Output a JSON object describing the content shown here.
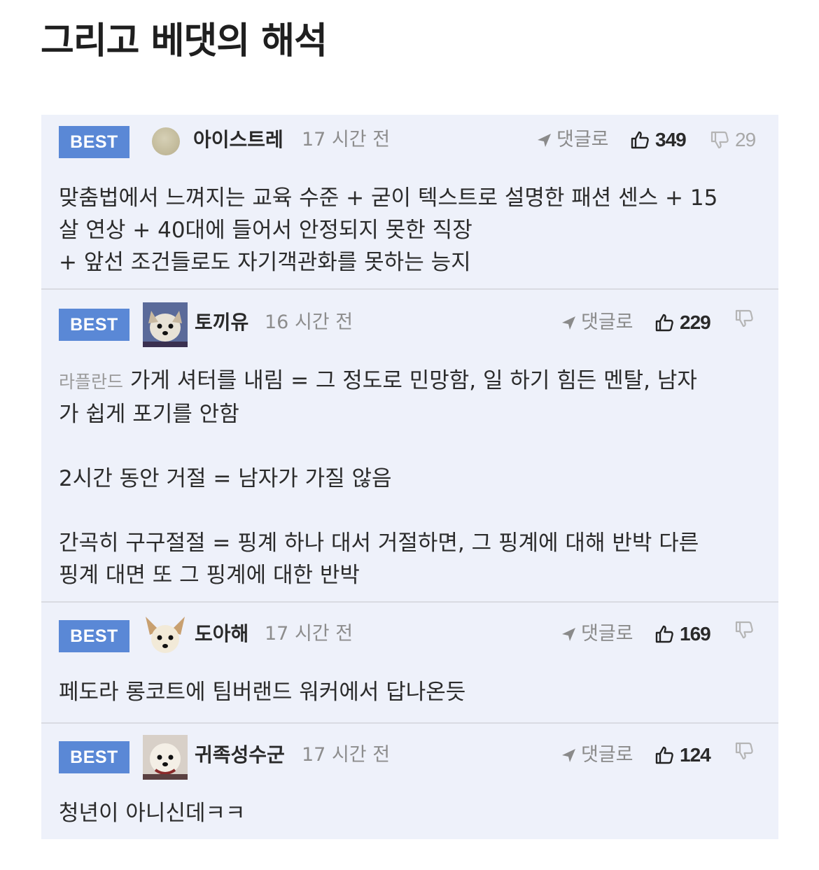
{
  "page": {
    "title": "그리고 베댓의 해석"
  },
  "ui": {
    "reply_label": "댓글로",
    "best_label": "BEST"
  },
  "colors": {
    "best_badge": "#5a88d6",
    "panel_bg": "#eef1fa",
    "divider": "#d9dbe2"
  },
  "comments": [
    {
      "username": "아이스트레",
      "time": "17 시간 전",
      "likes": "349",
      "dislikes": "29",
      "avatar_icon": "plain-circle-avatar",
      "lines": [
        "맞춤법에서 느껴지는 교육 수준 + 굳이 텍스트로 설명한 패션 센스 + 15",
        "살 연상 + 40대에 들어서 안정되지 못한 직장",
        "+ 앞선 조건들로도 자기객관화를 못하는 능지"
      ]
    },
    {
      "username": "토끼유",
      "time": "16 시간 전",
      "likes": "229",
      "dislikes": "",
      "avatar_icon": "dog-avatar",
      "mention": "라플란드",
      "lines": [
        "가게 셔터를 내림 = 그 정도로 민망함, 일 하기 힘든 멘탈, 남자",
        "가 쉽게 포기를 안함",
        "2시간 동안 거절 = 남자가 가질 않음",
        "간곡히 구구절절 = 핑계 하나 대서 거절하면, 그 핑계에 대해 반박 다른",
        "핑계 대면 또 그 핑계에 대한 반박"
      ]
    },
    {
      "username": "도아해",
      "time": "17 시간 전",
      "likes": "169",
      "dislikes": "",
      "avatar_icon": "chihuahua-avatar",
      "lines": [
        "페도라 롱코트에 팀버랜드 워커에서 답나온듯"
      ]
    },
    {
      "username": "귀족성수군",
      "time": "17 시간 전",
      "likes": "124",
      "dislikes": "",
      "avatar_icon": "dog-avatar",
      "lines": [
        "청년이 아니신데ㅋㅋ"
      ]
    }
  ]
}
